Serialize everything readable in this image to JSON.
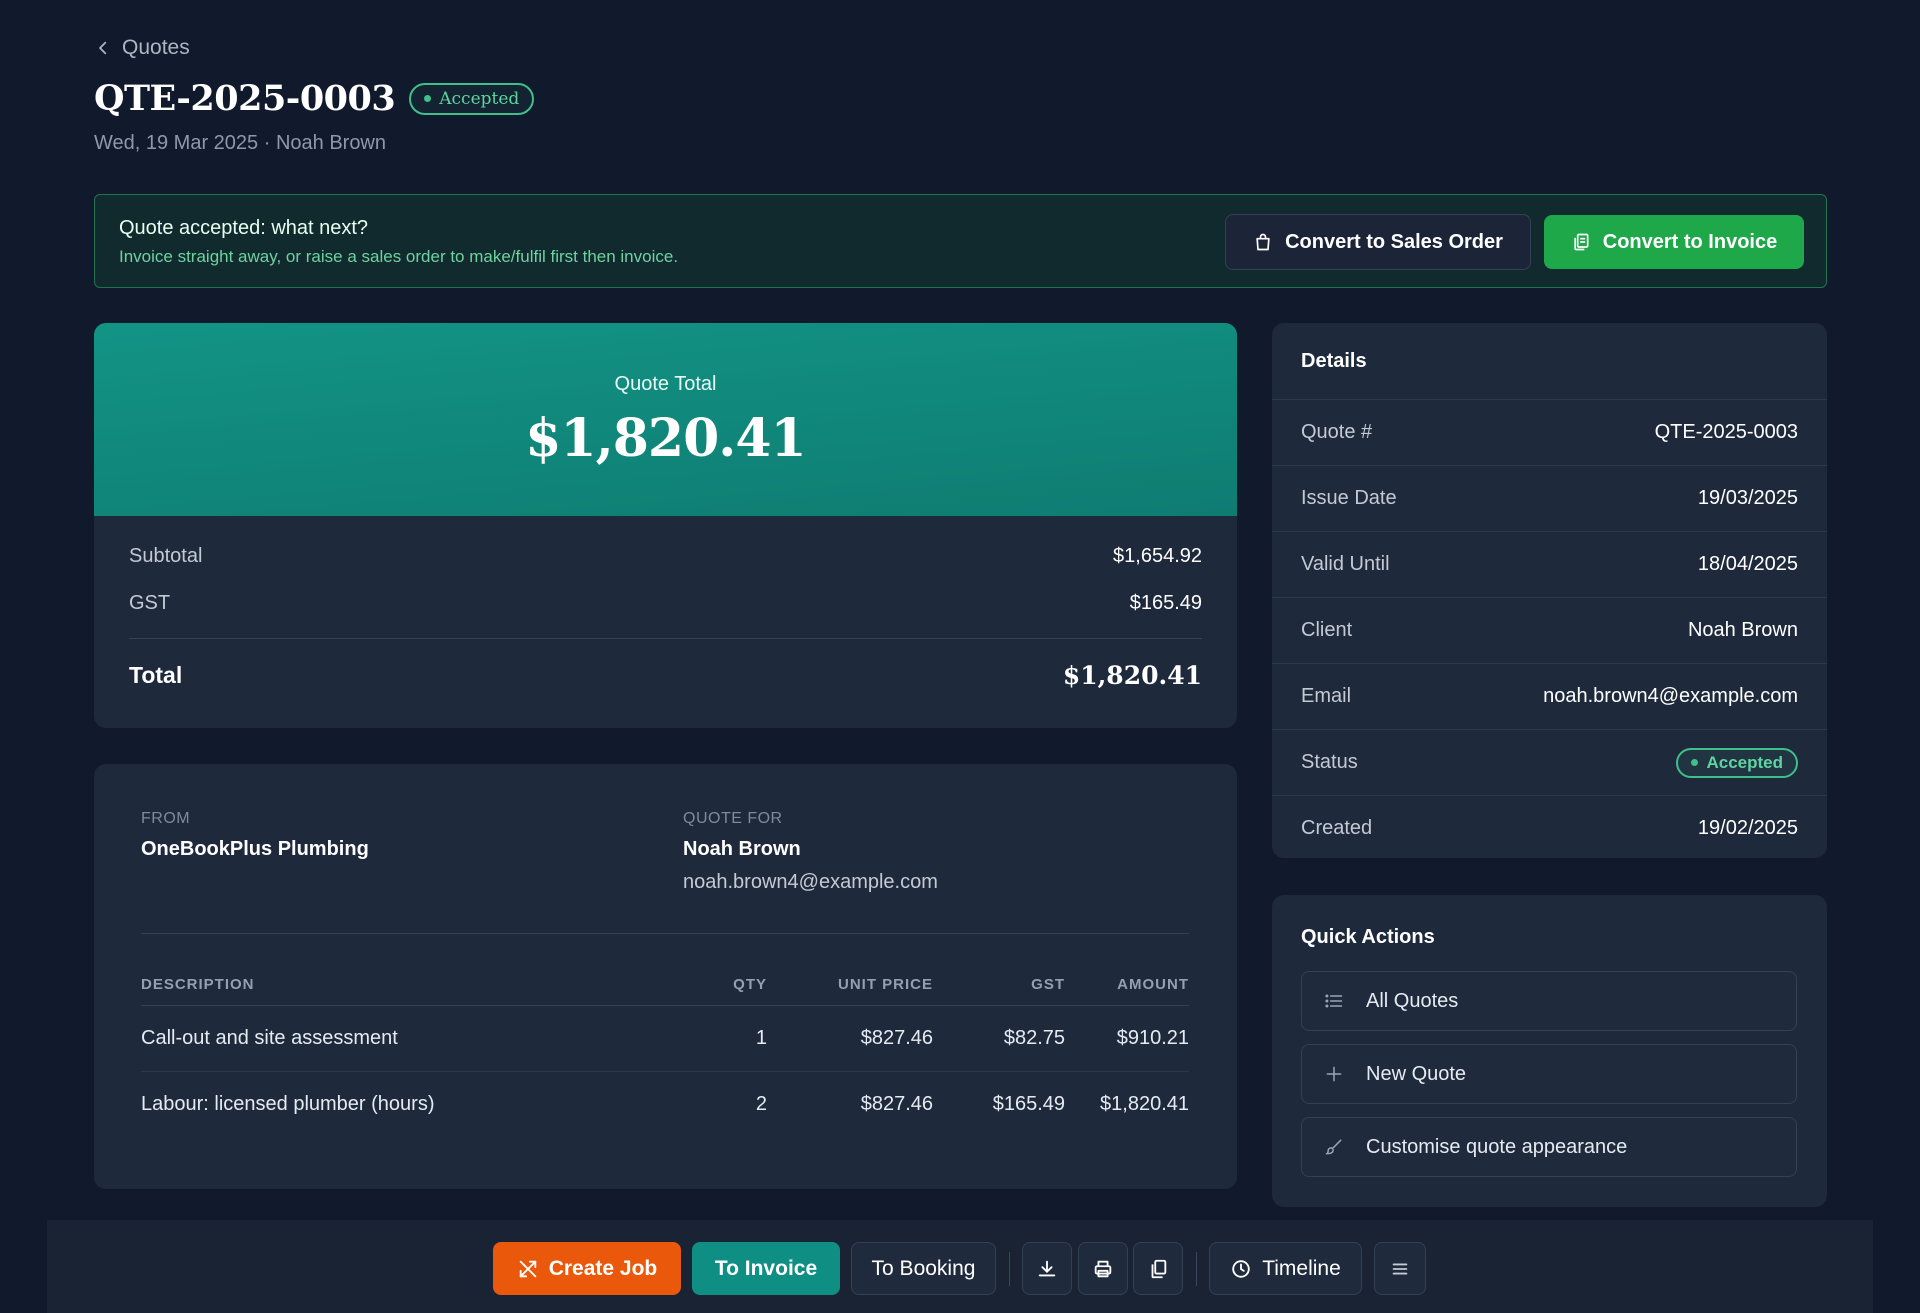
{
  "header": {
    "back_label": "Quotes",
    "title": "QTE-2025-0003",
    "status_badge": "Accepted",
    "subtitle": "Wed, 19 Mar 2025 · Noah Brown"
  },
  "banner": {
    "title": "Quote accepted: what next?",
    "subtitle": "Invoice straight away, or raise a sales order to make/fulfil first then invoice.",
    "sales_order_button": "Convert to Sales Order",
    "invoice_button": "Convert to Invoice"
  },
  "totals": {
    "label": "Quote Total",
    "value": "$1,820.41",
    "rows": [
      {
        "label": "Subtotal",
        "value": "$1,654.92"
      },
      {
        "label": "GST",
        "value": "$165.49"
      }
    ],
    "total_label": "Total",
    "total_value": "$1,820.41"
  },
  "parties": {
    "from_caption": "FROM",
    "from_name": "OneBookPlus Plumbing",
    "for_caption": "QUOTE FOR",
    "for_name": "Noah Brown",
    "for_email": "noah.brown4@example.com"
  },
  "items": {
    "columns": [
      "DESCRIPTION",
      "QTY",
      "UNIT PRICE",
      "GST",
      "AMOUNT"
    ],
    "rows": [
      [
        "Call-out and site assessment",
        "1",
        "$827.46",
        "$82.75",
        "$910.21"
      ],
      [
        "Labour: licensed plumber (hours)",
        "2",
        "$827.46",
        "$165.49",
        "$1,820.41"
      ]
    ]
  },
  "details": {
    "title": "Details",
    "rows": [
      {
        "label": "Quote #",
        "value": "QTE-2025-0003"
      },
      {
        "label": "Issue Date",
        "value": "19/03/2025"
      },
      {
        "label": "Valid Until",
        "value": "18/04/2025"
      },
      {
        "label": "Client",
        "value": "Noah Brown"
      },
      {
        "label": "Email",
        "value": "noah.brown4@example.com"
      },
      {
        "label": "Status",
        "value": "Accepted"
      },
      {
        "label": "Created",
        "value": "19/02/2025"
      }
    ]
  },
  "quick_actions": {
    "title": "Quick Actions",
    "items": [
      {
        "label": "All Quotes",
        "icon": "list-icon"
      },
      {
        "label": "New Quote",
        "icon": "plus-icon"
      },
      {
        "label": "Customise quote appearance",
        "icon": "brush-icon"
      }
    ]
  },
  "toolbar": {
    "create_job": "Create Job",
    "to_invoice": "To Invoice",
    "to_booking": "To Booking",
    "timeline": "Timeline"
  },
  "colors": {
    "background": "#111a2d",
    "card": "#1e293b",
    "accent_teal": "#0f8f84",
    "success_green": "#1fa84a",
    "orange": "#ea580c",
    "status_green": "#3fbf8a"
  }
}
